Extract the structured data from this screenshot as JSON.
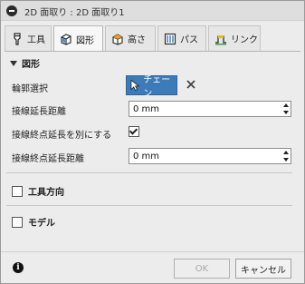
{
  "window": {
    "title": "2D 面取り : 2D 面取り1"
  },
  "tabs": [
    {
      "label": "工具",
      "icon": "tool-icon"
    },
    {
      "label": "図形",
      "icon": "shape-icon",
      "active": true
    },
    {
      "label": "高さ",
      "icon": "height-icon"
    },
    {
      "label": "パス",
      "icon": "path-icon"
    },
    {
      "label": "リンク",
      "icon": "link-icon"
    }
  ],
  "geometry": {
    "header": "図形",
    "contour_label": "輪郭選択",
    "chain_button": "チェーン",
    "tangent_ext_label": "接線延長距離",
    "tangent_ext_value": "0 mm",
    "separate_label": "接線終点延長を別にする",
    "separate_checked": true,
    "end_ext_label": "接線終点延長距離",
    "end_ext_value": "0 mm"
  },
  "groups": {
    "tool_orientation": "工具方向",
    "model": "モデル"
  },
  "footer": {
    "ok": "OK",
    "cancel": "キャンセル"
  },
  "colors": {
    "accent": "#3d7bb8"
  }
}
